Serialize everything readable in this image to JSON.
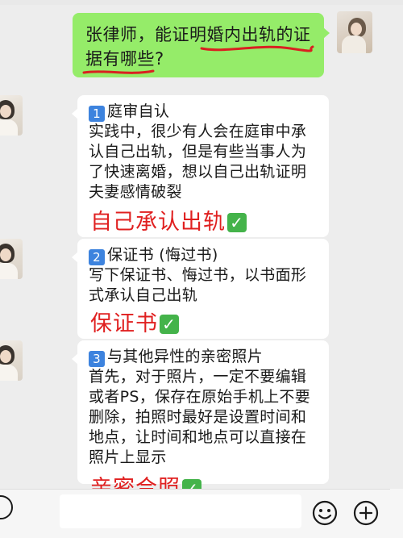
{
  "question": {
    "text": "张律师，能证明婚内出轨的证据有哪些?"
  },
  "answers": [
    {
      "number": "1",
      "heading": "庭审自认",
      "body": "实践中，很少有人会在庭审中承认自己出轨，但是有些当事人为了快速离婚，想以自己出轨证明 夫妻感情破裂",
      "label": "自己承认出轨"
    },
    {
      "number": "2",
      "heading": "保证书 (悔过书)",
      "body": "写下保证书、悔过书，以书面形式承认自己出轨",
      "label": "保证书"
    },
    {
      "number": "3",
      "heading": "与其他异性的亲密照片",
      "body": "首先，对于照片，一定不要编辑或者PS，保存在原始手机上不要删除，拍照时最好是设置时间和地点，让时间和地点可以直接在照片上显示",
      "label": "亲密合照"
    }
  ],
  "check_symbol": "✓",
  "input_bar": {
    "voice_icon": "voice-icon",
    "emoji_icon": "emoji-icon",
    "plus_icon": "plus-icon"
  },
  "colors": {
    "sent_bubble": "#95ec69",
    "received_bubble": "#ffffff",
    "background": "#ededed",
    "red_label": "#e02020",
    "number_badge": "#3d83de",
    "check": "#44b34a",
    "underline": "#d92020"
  }
}
